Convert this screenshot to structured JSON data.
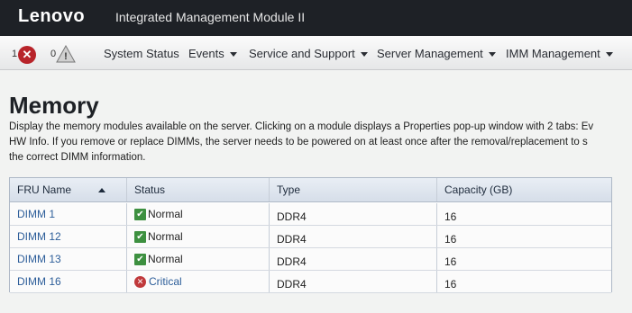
{
  "header": {
    "brand": "Lenovo",
    "product": "Integrated Management Module II"
  },
  "navbar": {
    "error_count": "1",
    "warning_count": "0",
    "items": [
      {
        "label": "System Status"
      },
      {
        "label": "Events"
      },
      {
        "label": "Service and Support"
      },
      {
        "label": "Server Management"
      },
      {
        "label": "IMM Management"
      }
    ]
  },
  "page": {
    "title": "Memory",
    "description_lines": [
      "Display the memory modules available on the server. Clicking on a module displays a Properties pop-up window with 2 tabs: Ev",
      "HW Info. If you remove or replace DIMMs, the server needs to be powered on at least once after the removal/replacement to s",
      "the correct DIMM information."
    ]
  },
  "table": {
    "columns": [
      "FRU Name",
      "Status",
      "Type",
      "Capacity (GB)"
    ],
    "rows": [
      {
        "name": "DIMM 1",
        "status": "Normal",
        "status_type": "ok",
        "type": "DDR4",
        "capacity": "16"
      },
      {
        "name": "DIMM 12",
        "status": "Normal",
        "status_type": "ok",
        "type": "DDR4",
        "capacity": "16"
      },
      {
        "name": "DIMM 13",
        "status": "Normal",
        "status_type": "ok",
        "type": "DDR4",
        "capacity": "16"
      },
      {
        "name": "DIMM 16",
        "status": "Critical",
        "status_type": "critical",
        "type": "DDR4",
        "capacity": "16"
      }
    ]
  },
  "colors": {
    "topbar": "#1e2126",
    "link": "#2c5d99",
    "ok": "#3d9040",
    "critical": "#c0393b"
  }
}
